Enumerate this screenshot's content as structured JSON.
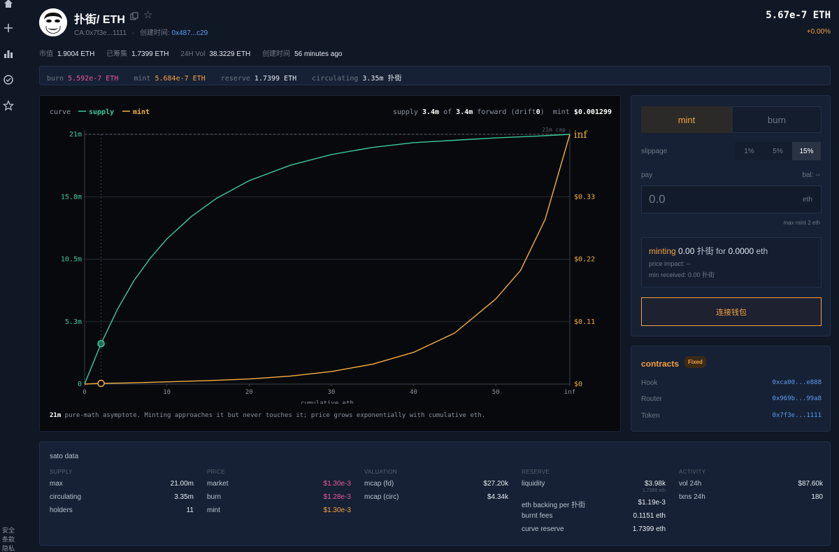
{
  "rail": {
    "icons": [
      "home-icon",
      "plus-icon",
      "bar-chart-icon",
      "check-circle-icon",
      "star-icon"
    ],
    "footer_lines": [
      "安全",
      "条款",
      "隐私"
    ]
  },
  "header": {
    "title": "扑街/ ETH",
    "ca_label": "CA:0x7f3e...1111",
    "separator": "·",
    "created_label": "创建时间:",
    "created_link": "0x487...c29",
    "price": "5.67e-7 ETH",
    "change": "+0.00%"
  },
  "stats": [
    {
      "label": "市值",
      "value": "1.9004 ETH"
    },
    {
      "label": "已筹集",
      "value": "1.7399 ETH"
    },
    {
      "label": "24H Vol",
      "value": "38.3229 ETH"
    },
    {
      "label": "创建时间",
      "value": "56 minutes ago"
    }
  ],
  "curve_strip": [
    {
      "label": "burn",
      "value": "5.592e-7 ETH",
      "color": "#e8579a"
    },
    {
      "label": "mint",
      "value": "5.684e-7 ETH",
      "color": "#f5a041"
    },
    {
      "label": "reserve",
      "value": "1.7399 ETH",
      "color": "#e6ebf2"
    },
    {
      "label": "circulating",
      "value": "3.35m 扑街",
      "color": "#e6ebf2"
    }
  ],
  "chart_header": {
    "legend_label": "curve",
    "supply_legend": "supply",
    "mint_legend": "mint",
    "supply_text": "supply",
    "supply_value": "3.4m",
    "of_text": "of",
    "total_value": "3.4m",
    "forward_text": "forward (drift",
    "drift_value": "0",
    "close_paren": ")",
    "mint_text": "mint",
    "mint_value": "$0.001299"
  },
  "chart_data": {
    "type": "line",
    "title": "",
    "xlabel": "cumulative eth",
    "x_ticks": [
      "0",
      "10",
      "20",
      "30",
      "40",
      "50",
      "inf"
    ],
    "xlim": [
      0,
      59
    ],
    "ylabel_left": "",
    "y_left_ticks": [
      "0",
      "5.3m",
      "10.5m",
      "15.8m",
      "21m"
    ],
    "y_left_lim": [
      0,
      21000000
    ],
    "y_right_ticks": [
      "$0",
      "$0.11",
      "$0.22",
      "$0.33",
      "inf"
    ],
    "cap_label": "21m cap",
    "grid": true,
    "legend_position": "top-left",
    "colors": {
      "supply": "#3ec99a",
      "mint": "#f5b041"
    },
    "series": [
      {
        "name": "supply",
        "x": [
          0,
          2,
          4,
          6,
          8,
          10,
          13,
          16,
          20,
          25,
          30,
          35,
          40,
          45,
          50,
          55,
          59
        ],
        "y": [
          0,
          3400000,
          6300000,
          8700000,
          10600000,
          12200000,
          14100000,
          15600000,
          17100000,
          18400000,
          19300000,
          19900000,
          20300000,
          20500000,
          20700000,
          20850000,
          21000000
        ]
      },
      {
        "name": "mint",
        "x": [
          0,
          2,
          5,
          10,
          15,
          20,
          25,
          30,
          35,
          40,
          45,
          50,
          53,
          56,
          59
        ],
        "y": [
          0,
          0.0013,
          0.002,
          0.004,
          0.006,
          0.009,
          0.014,
          0.022,
          0.035,
          0.056,
          0.09,
          0.15,
          0.2,
          0.29,
          0.44
        ]
      }
    ],
    "markers": [
      {
        "series": "supply",
        "x": 2,
        "y": 3400000
      },
      {
        "series": "mint",
        "x": 2,
        "y": 0.0013
      }
    ]
  },
  "chart_note": {
    "bold": "21m",
    "rest": " pure-math asymptote. Minting approaches it but never touches it; price grows exponentially with cumulative eth."
  },
  "trade": {
    "tab_mint": "mint",
    "tab_burn": "burn",
    "slippage_label": "slippage",
    "slippage_options": [
      "1%",
      "5%",
      "15%"
    ],
    "pay_label": "pay",
    "balance": "bal: --",
    "pay_placeholder": "0.0",
    "pay_unit": "eth",
    "max_mint": "max mint 2 eth",
    "quote_action": "minting",
    "quote_amount": "0.00",
    "quote_token": "扑街",
    "quote_for": "for",
    "quote_eth": "0.0000",
    "quote_unit": "eth",
    "price_impact": "price impact: --",
    "min_received": "min received: 0.00 扑街",
    "connect_button": "连接钱包"
  },
  "contracts": {
    "title": "contracts",
    "badge": "Fixed",
    "rows": [
      {
        "name": "Hook",
        "address": "0xca00...e888"
      },
      {
        "name": "Router",
        "address": "0x969b...99a8"
      },
      {
        "name": "Token",
        "address": "0x7f3e...1111"
      }
    ]
  },
  "sato": {
    "title": "sato data",
    "supply": {
      "head": "SUPPLY",
      "rows": [
        {
          "k": "max",
          "v": "21.00m"
        },
        {
          "k": "circulating",
          "v": "3.35m"
        },
        {
          "k": "holders",
          "v": "11"
        }
      ]
    },
    "price": {
      "head": "PRICE",
      "rows": [
        {
          "k": "market",
          "v": "$1.30e-3"
        },
        {
          "k": "burn",
          "v": "$1.28e-3"
        },
        {
          "k": "mint",
          "v": "$1.30e-3"
        }
      ]
    },
    "valuation": {
      "head": "VALUATION",
      "rows": [
        {
          "k": "mcap (fd)",
          "v": "$27.20k"
        },
        {
          "k": "mcap (circ)",
          "v": "$4.34k"
        }
      ]
    },
    "reserve": {
      "head": "RESERVE",
      "rows": [
        {
          "k": "liquidity",
          "v": "$3.98k",
          "sub": "1.7399 eth"
        },
        {
          "k": "eth backing per 扑街",
          "v": "$1.19e-3"
        },
        {
          "k": "burnt fees",
          "v": "0.1151 eth"
        },
        {
          "k": "curve reserve",
          "v": "1.7399 eth"
        }
      ]
    },
    "activity": {
      "head": "ACTIVITY",
      "rows": [
        {
          "k": "vol 24h",
          "v": "$87.60k"
        },
        {
          "k": "txns 24h",
          "v": "180"
        }
      ]
    }
  }
}
